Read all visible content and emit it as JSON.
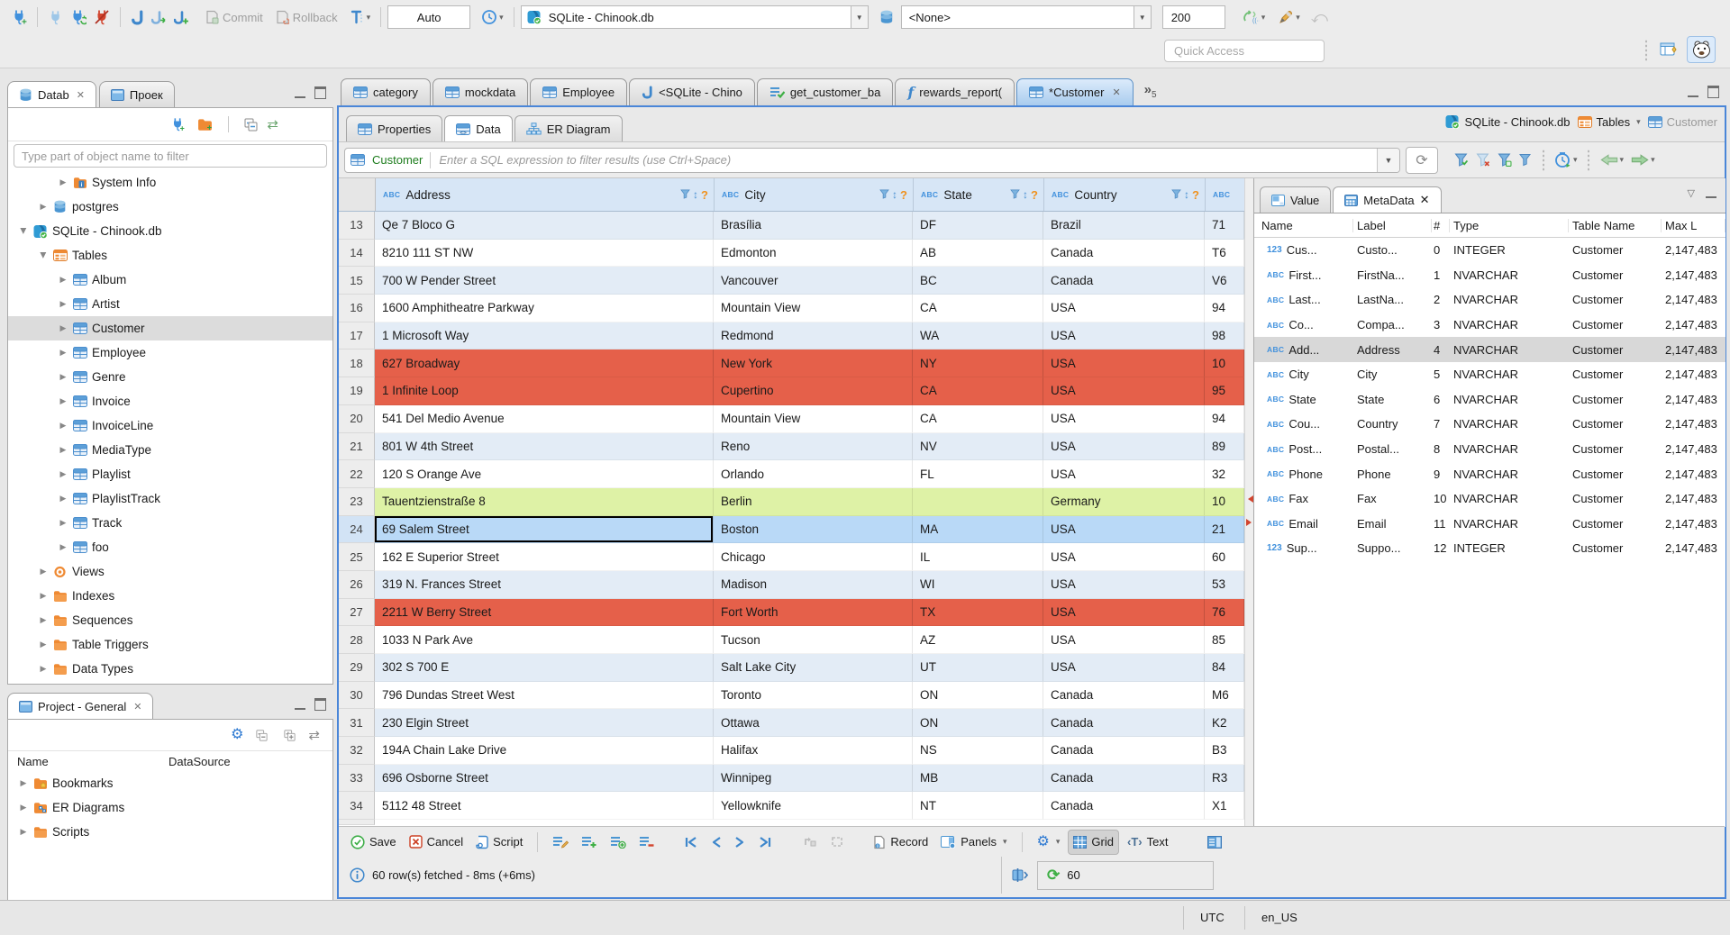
{
  "app": {
    "quick_access_placeholder": "Quick Access",
    "timezone": "UTC",
    "locale": "en_US"
  },
  "icons": {
    "close": "✕",
    "dropdown_caret": "▾",
    "dropdown_arrow": "▼",
    "sort_arrows": "↕",
    "filter_help": "?",
    "more_chevron": "»",
    "link_arrows": "⇄",
    "refresh": "⟳",
    "undo": "⤺",
    "abc": "ABC",
    "num123": "123"
  },
  "toolbar": {
    "commit": "Commit",
    "rollback": "Rollback",
    "txn_mode": "Auto",
    "connection": "SQLite - Chinook.db",
    "schema": "<None>",
    "fetch_size": "200"
  },
  "navigator": {
    "tab_database": "Datab",
    "tab_projects": "Проек",
    "filter_placeholder": "Type part of object name to filter",
    "tree": [
      {
        "label": "System Info",
        "icon": "folder-info",
        "indent": 56,
        "expanded": false
      },
      {
        "label": "postgres",
        "icon": "database",
        "indent": 34,
        "expanded": false
      },
      {
        "label": "SQLite - Chinook.db",
        "icon": "sqlite",
        "indent": 12,
        "expanded": true
      },
      {
        "label": "Tables",
        "icon": "folder-table",
        "indent": 34,
        "expanded": true
      },
      {
        "label": "Album",
        "icon": "table",
        "indent": 56,
        "expanded": false
      },
      {
        "label": "Artist",
        "icon": "table",
        "indent": 56,
        "expanded": false
      },
      {
        "label": "Customer",
        "icon": "table",
        "indent": 56,
        "expanded": false,
        "selected": true
      },
      {
        "label": "Employee",
        "icon": "table",
        "indent": 56,
        "expanded": false
      },
      {
        "label": "Genre",
        "icon": "table",
        "indent": 56,
        "expanded": false
      },
      {
        "label": "Invoice",
        "icon": "table",
        "indent": 56,
        "expanded": false
      },
      {
        "label": "InvoiceLine",
        "icon": "table",
        "indent": 56,
        "expanded": false
      },
      {
        "label": "MediaType",
        "icon": "table",
        "indent": 56,
        "expanded": false
      },
      {
        "label": "Playlist",
        "icon": "table",
        "indent": 56,
        "expanded": false
      },
      {
        "label": "PlaylistTrack",
        "icon": "table",
        "indent": 56,
        "expanded": false
      },
      {
        "label": "Track",
        "icon": "table",
        "indent": 56,
        "expanded": false
      },
      {
        "label": "foo",
        "icon": "table",
        "indent": 56,
        "expanded": false
      },
      {
        "label": "Views",
        "icon": "views",
        "indent": 34,
        "expanded": false
      },
      {
        "label": "Indexes",
        "icon": "folder",
        "indent": 34,
        "expanded": false
      },
      {
        "label": "Sequences",
        "icon": "folder",
        "indent": 34,
        "expanded": false
      },
      {
        "label": "Table Triggers",
        "icon": "folder",
        "indent": 34,
        "expanded": false
      },
      {
        "label": "Data Types",
        "icon": "folder",
        "indent": 34,
        "expanded": false
      }
    ]
  },
  "project_panel": {
    "tab": "Project - General",
    "columns": [
      "Name",
      "DataSource"
    ],
    "items": [
      {
        "label": "Bookmarks",
        "icon": "folder-bookmarks"
      },
      {
        "label": "ER Diagrams",
        "icon": "folder-er"
      },
      {
        "label": "Scripts",
        "icon": "folder"
      }
    ]
  },
  "editor": {
    "tabs": [
      {
        "label": "category",
        "icon": "table",
        "active": false
      },
      {
        "label": "mockdata",
        "icon": "table",
        "active": false
      },
      {
        "label": "Employee",
        "icon": "table",
        "active": false
      },
      {
        "label": "<SQLite - Chino",
        "icon": "sql-script",
        "active": false
      },
      {
        "label": "get_customer_ba",
        "icon": "sql-script-check",
        "active": false
      },
      {
        "label": "rewards_report(",
        "icon": "function",
        "active": false
      },
      {
        "label": "*Customer",
        "icon": "table",
        "active": true,
        "closable": true
      }
    ],
    "more_tabs_count": "5",
    "subtabs": [
      {
        "label": "Properties",
        "icon": "table",
        "active": false
      },
      {
        "label": "Data",
        "icon": "grid-data",
        "active": true
      },
      {
        "label": "ER Diagram",
        "icon": "diagram",
        "active": false
      }
    ],
    "breadcrumb": [
      {
        "label": "SQLite - Chinook.db",
        "icon": "sqlite"
      },
      {
        "label": "Tables",
        "icon": "folder-table",
        "dropdown": true
      },
      {
        "label": "Customer",
        "icon": "table",
        "muted": true
      }
    ],
    "filter_table": "Customer",
    "filter_placeholder": "Enter a SQL expression to filter results (use Ctrl+Space)"
  },
  "grid": {
    "columns": [
      {
        "label": "Address"
      },
      {
        "label": "City"
      },
      {
        "label": "State"
      },
      {
        "label": "Country"
      },
      {
        "label": ""
      }
    ],
    "rows": [
      {
        "n": "13",
        "address": "Qe 7 Bloco G",
        "city": "Brasília",
        "state": "DF",
        "country": "Brazil",
        "postal": "71",
        "style": "alt"
      },
      {
        "n": "14",
        "address": "8210 111 ST NW",
        "city": "Edmonton",
        "state": "AB",
        "country": "Canada",
        "postal": "T6",
        "style": "plain"
      },
      {
        "n": "15",
        "address": "700 W Pender Street",
        "city": "Vancouver",
        "state": "BC",
        "country": "Canada",
        "postal": "V6",
        "style": "alt"
      },
      {
        "n": "16",
        "address": "1600 Amphitheatre Parkway",
        "city": "Mountain View",
        "state": "CA",
        "country": "USA",
        "postal": "94",
        "style": "plain"
      },
      {
        "n": "17",
        "address": "1 Microsoft Way",
        "city": "Redmond",
        "state": "WA",
        "country": "USA",
        "postal": "98",
        "style": "alt"
      },
      {
        "n": "18",
        "address": "627 Broadway",
        "city": "New York",
        "state": "NY",
        "country": "USA",
        "postal": "10",
        "style": "red"
      },
      {
        "n": "19",
        "address": "1 Infinite Loop",
        "city": "Cupertino",
        "state": "CA",
        "country": "USA",
        "postal": "95",
        "style": "red"
      },
      {
        "n": "20",
        "address": "541 Del Medio Avenue",
        "city": "Mountain View",
        "state": "CA",
        "country": "USA",
        "postal": "94",
        "style": "plain"
      },
      {
        "n": "21",
        "address": "801 W 4th Street",
        "city": "Reno",
        "state": "NV",
        "country": "USA",
        "postal": "89",
        "style": "alt"
      },
      {
        "n": "22",
        "address": "120 S Orange Ave",
        "city": "Orlando",
        "state": "FL",
        "country": "USA",
        "postal": "32",
        "style": "plain"
      },
      {
        "n": "23",
        "address": "Tauentzienstraße 8",
        "city": "Berlin",
        "state": "",
        "country": "Germany",
        "postal": "10",
        "style": "green"
      },
      {
        "n": "24",
        "address": "69 Salem Street",
        "city": "Boston",
        "state": "MA",
        "country": "USA",
        "postal": "21",
        "style": "selected"
      },
      {
        "n": "25",
        "address": "162 E Superior Street",
        "city": "Chicago",
        "state": "IL",
        "country": "USA",
        "postal": "60",
        "style": "plain"
      },
      {
        "n": "26",
        "address": "319 N. Frances Street",
        "city": "Madison",
        "state": "WI",
        "country": "USA",
        "postal": "53",
        "style": "alt"
      },
      {
        "n": "27",
        "address": "2211 W Berry Street",
        "city": "Fort Worth",
        "state": "TX",
        "country": "USA",
        "postal": "76",
        "style": "red"
      },
      {
        "n": "28",
        "address": "1033 N Park Ave",
        "city": "Tucson",
        "state": "AZ",
        "country": "USA",
        "postal": "85",
        "style": "plain"
      },
      {
        "n": "29",
        "address": "302 S 700 E",
        "city": "Salt Lake City",
        "state": "UT",
        "country": "USA",
        "postal": "84",
        "style": "alt"
      },
      {
        "n": "30",
        "address": "796 Dundas Street West",
        "city": "Toronto",
        "state": "ON",
        "country": "Canada",
        "postal": "M6",
        "style": "plain"
      },
      {
        "n": "31",
        "address": "230 Elgin Street",
        "city": "Ottawa",
        "state": "ON",
        "country": "Canada",
        "postal": "K2",
        "style": "alt"
      },
      {
        "n": "32",
        "address": "194A Chain Lake Drive",
        "city": "Halifax",
        "state": "NS",
        "country": "Canada",
        "postal": "B3",
        "style": "plain"
      },
      {
        "n": "33",
        "address": "696 Osborne Street",
        "city": "Winnipeg",
        "state": "MB",
        "country": "Canada",
        "postal": "R3",
        "style": "alt"
      },
      {
        "n": "34",
        "address": "5112 48 Street",
        "city": "Yellowknife",
        "state": "NT",
        "country": "Canada",
        "postal": "X1",
        "style": "plain"
      }
    ]
  },
  "metadata": {
    "tab_value": "Value",
    "tab_metadata": "MetaData",
    "columns": [
      "Name",
      "Label",
      "#",
      "Type",
      "Table Name",
      "Max L"
    ],
    "rows": [
      {
        "icon": "123",
        "name": "Cus...",
        "label": "Custo...",
        "num": "0",
        "type": "INTEGER",
        "table": "Customer",
        "max": "2,147,483"
      },
      {
        "icon": "ABC",
        "name": "First...",
        "label": "FirstNa...",
        "num": "1",
        "type": "NVARCHAR",
        "table": "Customer",
        "max": "2,147,483"
      },
      {
        "icon": "ABC",
        "name": "Last...",
        "label": "LastNa...",
        "num": "2",
        "type": "NVARCHAR",
        "table": "Customer",
        "max": "2,147,483"
      },
      {
        "icon": "ABC",
        "name": "Co...",
        "label": "Compa...",
        "num": "3",
        "type": "NVARCHAR",
        "table": "Customer",
        "max": "2,147,483"
      },
      {
        "icon": "ABC",
        "name": "Add...",
        "label": "Address",
        "num": "4",
        "type": "NVARCHAR",
        "table": "Customer",
        "max": "2,147,483",
        "selected": true
      },
      {
        "icon": "ABC",
        "name": "City",
        "label": "City",
        "num": "5",
        "type": "NVARCHAR",
        "table": "Customer",
        "max": "2,147,483"
      },
      {
        "icon": "ABC",
        "name": "State",
        "label": "State",
        "num": "6",
        "type": "NVARCHAR",
        "table": "Customer",
        "max": "2,147,483"
      },
      {
        "icon": "ABC",
        "name": "Cou...",
        "label": "Country",
        "num": "7",
        "type": "NVARCHAR",
        "table": "Customer",
        "max": "2,147,483"
      },
      {
        "icon": "ABC",
        "name": "Post...",
        "label": "Postal...",
        "num": "8",
        "type": "NVARCHAR",
        "table": "Customer",
        "max": "2,147,483"
      },
      {
        "icon": "ABC",
        "name": "Phone",
        "label": "Phone",
        "num": "9",
        "type": "NVARCHAR",
        "table": "Customer",
        "max": "2,147,483"
      },
      {
        "icon": "ABC",
        "name": "Fax",
        "label": "Fax",
        "num": "10",
        "type": "NVARCHAR",
        "table": "Customer",
        "max": "2,147,483"
      },
      {
        "icon": "ABC",
        "name": "Email",
        "label": "Email",
        "num": "11",
        "type": "NVARCHAR",
        "table": "Customer",
        "max": "2,147,483"
      },
      {
        "icon": "123",
        "name": "Sup...",
        "label": "Suppo...",
        "num": "12",
        "type": "INTEGER",
        "table": "Customer",
        "max": "2,147,483"
      }
    ]
  },
  "results_toolbar": {
    "save": "Save",
    "cancel": "Cancel",
    "script": "Script",
    "record": "Record",
    "panels": "Panels",
    "grid": "Grid",
    "text": "Text"
  },
  "status": {
    "message": "60 row(s) fetched - 8ms (+6ms)",
    "auto_refresh": "60"
  }
}
